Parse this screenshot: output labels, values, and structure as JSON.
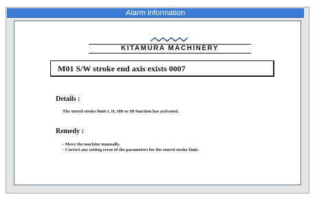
{
  "window": {
    "title": "Alarm information"
  },
  "logo": {
    "brand": "KITAMURA MACHINERY"
  },
  "alarm": {
    "message": "M01 S/W stroke end axis exists 0007"
  },
  "details": {
    "heading": "Details :",
    "text": "The stored stroke limit I, II, IIB or IB function has activated."
  },
  "remedy": {
    "heading": "Remedy :",
    "items": [
      "- Move the machine manually.",
      "- Correct any setting error of the parameters for the stored stroke limit."
    ]
  }
}
